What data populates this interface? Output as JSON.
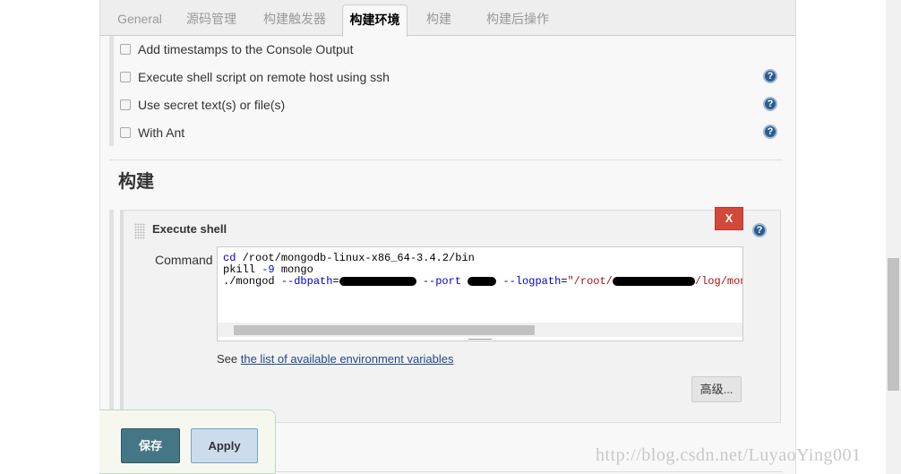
{
  "tabs": [
    "General",
    "源码管理",
    "构建触发器",
    "构建环境",
    "构建",
    "构建后操作"
  ],
  "active_tab": "构建环境",
  "build_env_options": [
    {
      "label": "Add timestamps to the Console Output",
      "checked": false,
      "help": false
    },
    {
      "label": "Execute shell script on remote host using ssh",
      "checked": false,
      "help": true
    },
    {
      "label": "Use secret text(s) or file(s)",
      "checked": false,
      "help": true
    },
    {
      "label": "With Ant",
      "checked": false,
      "help": true
    }
  ],
  "build_section": {
    "title": "构建",
    "step": {
      "title": "Execute shell",
      "delete_label": "X",
      "command_label": "Command",
      "command_lines": {
        "l1_kw": "cd",
        "l1_rest": " /root/mongodb-linux-x86_64-3.4.2/bin",
        "l2_a": "pkill ",
        "l2_kw": "-9",
        "l2_b": " mongo",
        "l3_a": "./mongod ",
        "l3_kw1": "--dbpath",
        "l3_eq": "=",
        "l3_kw2": "--port",
        "l3_kw3": "--logpath",
        "l3_str1": "\"/root/",
        "l3_str2": "/log/mongodb_"
      },
      "see_prefix": "See ",
      "see_link": "the list of available environment variables",
      "advanced_label": "高级..."
    }
  },
  "footer": {
    "save_label": "保存",
    "apply_label": "Apply"
  },
  "watermark": "http://blog.csdn.net/LuyaoYing001",
  "colors": {
    "save": "#447686",
    "apply": "#ccdcec",
    "delete": "#d24939",
    "help": "#2d5d8f"
  }
}
